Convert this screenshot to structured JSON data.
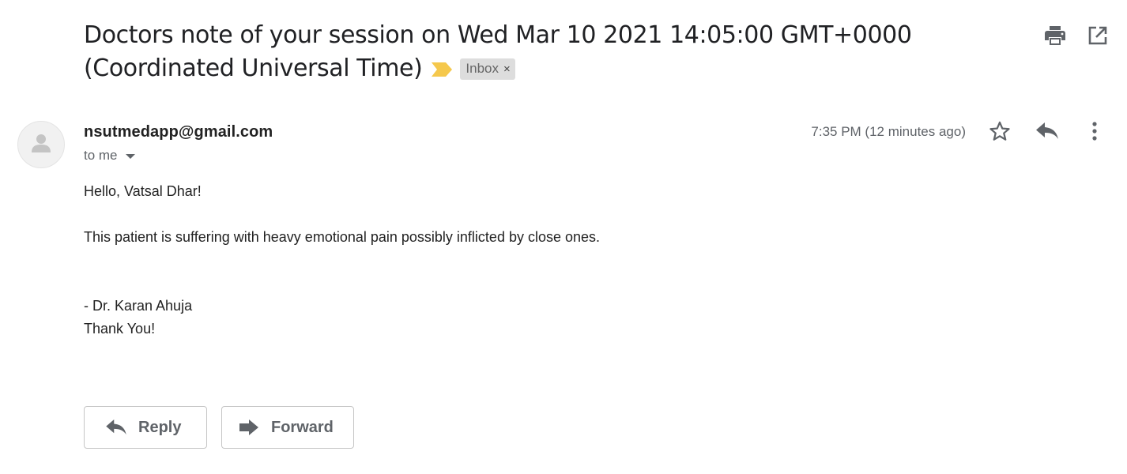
{
  "email": {
    "subject": "Doctors note of your session on Wed Mar 10 2021 14:05:00 GMT+0000 (Coordinated Universal Time)",
    "labels": [
      {
        "name": "Inbox",
        "remove_symbol": "×"
      }
    ],
    "important_marker_color": "#f5c84c",
    "sender_email": "nsutmedapp@gmail.com",
    "recipient_text": "to me",
    "timestamp": "7:35 PM (12 minutes ago)",
    "body": {
      "greeting": "Hello, Vatsal Dhar!",
      "paragraph": "This patient is suffering with heavy emotional pain possibly inflicted by close ones.",
      "signature": "- Dr. Karan Ahuja",
      "closing": "Thank You!"
    }
  },
  "toolbar": {
    "icons": [
      "print-icon",
      "open-in-new-window-icon"
    ]
  },
  "message_actions": {
    "icons": [
      "star-icon",
      "reply-icon",
      "more-options-icon"
    ]
  },
  "buttons": {
    "reply_label": "Reply",
    "forward_label": "Forward"
  },
  "colors": {
    "icon_gray": "#5f6368",
    "chip_background": "#dddddd",
    "button_border": "#c6c6c6"
  }
}
